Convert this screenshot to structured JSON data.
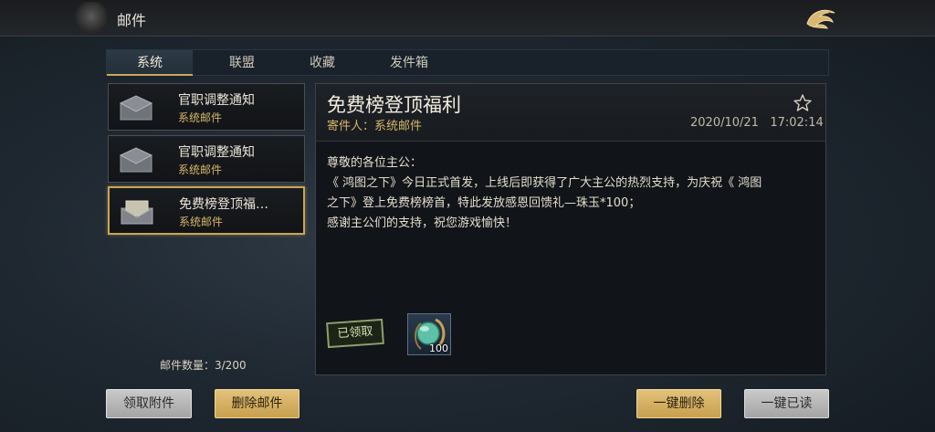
{
  "header": {
    "title": "邮件",
    "back_icon": "dragon-back-icon"
  },
  "tabs": [
    {
      "label": "系统",
      "active": true
    },
    {
      "label": "联盟",
      "active": false
    },
    {
      "label": "收藏",
      "active": false
    },
    {
      "label": "发件箱",
      "active": false
    }
  ],
  "mail_list": [
    {
      "subject": "官职调整通知",
      "from": "系统邮件",
      "selected": false,
      "icon": "envelope-icon"
    },
    {
      "subject": "官职调整通知",
      "from": "系统邮件",
      "selected": false,
      "icon": "envelope-icon"
    },
    {
      "subject": "免费榜登顶福…",
      "from": "系统邮件",
      "selected": true,
      "icon": "envelope-open-icon"
    }
  ],
  "mail_count": "邮件数量：3/200",
  "detail": {
    "title": "免费榜登顶福利",
    "sender": "寄件人：系统邮件",
    "date": "2020/10/21",
    "time": "17:02:14",
    "body": [
      "尊敬的各位主公：",
      "《 鸿图之下》今日正式首发，上线后即获得了广大主公的热烈支持，为庆祝《 鸿图",
      "之下》登上免费榜榜首，特此发放感恩回馈礼—珠玉*100；",
      "感谢主公们的支持，祝您游戏愉快！"
    ],
    "claimed_label": "已领取",
    "attachment": {
      "name": "珠玉",
      "quantity": "100",
      "icon": "jade-gem-icon"
    }
  },
  "buttons": {
    "claim_attachments": "领取附件",
    "delete_mail": "删除邮件",
    "delete_all": "一键删除",
    "read_all": "一键已读"
  },
  "colors": {
    "accent_gold": "#c9a555",
    "sender_gold": "#d4b768"
  }
}
